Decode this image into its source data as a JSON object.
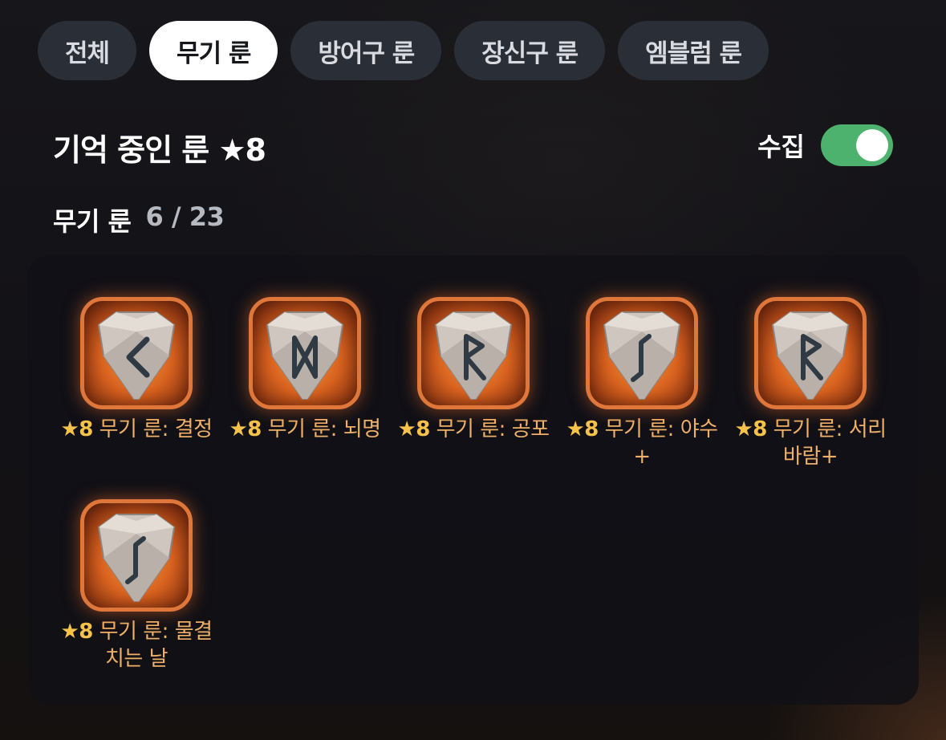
{
  "tabs": [
    {
      "label": "전체",
      "active": false
    },
    {
      "label": "무기 룬",
      "active": true
    },
    {
      "label": "방어구 룬",
      "active": false
    },
    {
      "label": "장신구 룬",
      "active": false
    },
    {
      "label": "엠블럼 룬",
      "active": false
    }
  ],
  "header": {
    "title": "기억 중인 룬 ★8",
    "collect_label": "수집",
    "collect_on": true
  },
  "count": {
    "label": "무기 룬",
    "value": "6 / 23"
  },
  "runes": [
    {
      "star": "★8",
      "name": "무기 룬: 결정",
      "glyph": "kaunan"
    },
    {
      "star": "★8",
      "name": "무기 룬: 뇌명",
      "glyph": "dagaz"
    },
    {
      "star": "★8",
      "name": "무기 룬: 공포",
      "glyph": "raido"
    },
    {
      "star": "★8",
      "name": "무기 룬: 야수+",
      "glyph": "eihwaz"
    },
    {
      "star": "★8",
      "name": "무기 룬: 서리바람+",
      "glyph": "raido"
    },
    {
      "star": "★8",
      "name": "무기 룬: 물결치는 날",
      "glyph": "eihwaz"
    }
  ],
  "colors": {
    "accent_orange": "#e0773a",
    "toggle_green": "#4cb26d",
    "rune_text": "#f0b067"
  }
}
